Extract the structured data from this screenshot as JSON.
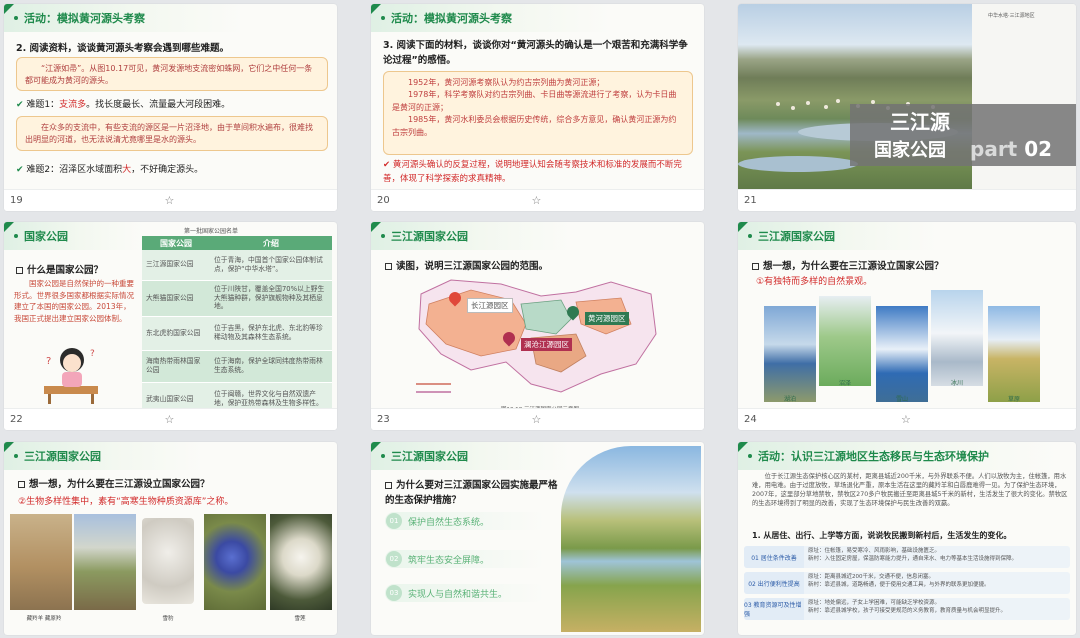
{
  "s19": {
    "num": "19",
    "title": "活动：模拟黄河源头考察",
    "q": "2.  阅读资料，谈谈黄河源头考察会遇到哪些难题。",
    "box1": "“江源如帚”。从图10.17可见，黄河发源地支流密如蛛网，它们之中任何一条都可能成为黄河的源头。",
    "d1a": "难题1：",
    "d1b": "支流多",
    "d1c": "。找长度最长、流量最大河段困难。",
    "box2": "在众多的支流中，有些支流的源区是一片沼泽地，由于草间积水遍布，很难找出明显的河道，也无法说清尤竟哪里是水的源头。",
    "d2a": "难题2：沼泽区水域面积",
    "d2b": "大",
    "d2c": "，不好确定源头。"
  },
  "s20": {
    "num": "20",
    "title": "活动：模拟黄河源头考察",
    "q": "3.  阅读下面的材料，谈谈你对“黄河源头的确认是一个艰苦和充满科学争论过程”的感悟。",
    "p1": "1952年，黄河河源考察队认为约古宗列曲为黄河正源；",
    "p2": "1978年，科学考察队对约古宗列曲、卡日曲等源流进行了考察，认为卡日曲是黄河的正源；",
    "p3": "1985年，黄河水利委员会根据历史传统，综合多方意见，确认黄河正源为约古宗列曲。",
    "tip": "黄河源头确认的反复过程，说明地理认知会随考察技术和标准的发展而不断完善，体现了科学探索的求真精神。"
  },
  "s21": {
    "num": "21",
    "tag": "中华水塔·三江源地区",
    "t1": "三江源",
    "t2": "国家公园",
    "part": "part",
    "pnum": "02"
  },
  "s22": {
    "num": "22",
    "title": "国家公园",
    "q": "什么是国家公园？",
    "body": "国家公园是自然保护的一种重要形式。世界很多国家都根据实际情况建立了本国的国家公园。2013年，我国正式提出建立国家公园体制。",
    "caption": "第一批国家公园名单",
    "h1": "国家公园",
    "h2": "介绍",
    "rows": [
      [
        "三江源国家公园",
        "位于青海，中国首个国家公园体制试点，保护“中华水塔”。"
      ],
      [
        "大熊猫国家公园",
        "位于川陕甘，覆盖全国70%以上野生大熊猫种群，保护旗舰物种及其栖息地。"
      ],
      [
        "东北虎豹国家公园",
        "位于吉黑，保护东北虎、东北豹等珍稀动物及其森林生态系统。"
      ],
      [
        "海南热带雨林国家公园",
        "位于海南，保护全球同纬度热带雨林生态系统。"
      ],
      [
        "武夷山国家公园",
        "位于闽赣，世界文化与自然双遗产地，保护亚热带森林及生物多样性。"
      ]
    ]
  },
  "s23": {
    "num": "23",
    "title": "三江源国家公园",
    "q": "读图，说明三江源国家公园的范围。",
    "l1": "长江源园区",
    "l2": "黄河源园区",
    "l3": "澜沧江源园区",
    "fig": "图10.18  三江源国家公园示意图"
  },
  "s24": {
    "num": "24",
    "title": "三江源国家公园",
    "q": "想一想，为什么要在三江源设立国家公园？",
    "a": "①有独特而多样的自然景观。",
    "photos": [
      "湖泊",
      "沼泽",
      "雪山",
      "冰川",
      "草原"
    ]
  },
  "s25": {
    "num": "",
    "title": "三江源国家公园",
    "q": "想一想，为什么要在三江源设立国家公园？",
    "a": "②生物多样性集中，素有“高寒生物种质资源库”之称。",
    "photos": [
      "藏羚羊 藏原羚",
      "",
      "雪豹",
      "",
      "雪莲"
    ]
  },
  "s26": {
    "num": "",
    "title": "三江源国家公园",
    "q": "为什么要对三江源国家公园实施最严格的生态保护措施？",
    "items": [
      {
        "n": "01",
        "t": "保护自然生态系统。"
      },
      {
        "n": "02",
        "t": "筑牢生态安全屏障。"
      },
      {
        "n": "03",
        "t": "实现人与自然和谐共生。"
      }
    ]
  },
  "s27": {
    "num": "",
    "title": "活动：认识三江源地区生态移民与生态环境保护",
    "body": "位于长江源生态保护核心区的某村，距离县城近200千米，与外界联系不便。人们以放牧为主，住帐篷，用水难，用电难。由于过度放牧，草场退化严重，原本生活在这里的藏羚羊和白唇鹿难得一见。为了保护生态环境，2007年，这里部分草地禁牧，禁牧区270多户牧民搬迁至距离县城5千米的新村，生活发生了很大的变化。禁牧区的生态环境得到了明显的改善，实现了生态环境保护与民生改善的双赢。",
    "q": "1. 从居住、出行、上学等方面，说说牧民搬到新村后，生活发生的变化。",
    "rows": [
      {
        "l": "01 居住条件改善",
        "t1": "原址：住帐篷，易受寒冷、风雨影响，基础设施匮乏。",
        "t2": "新村：入住固定房屋，保温防寒能力提升，通自来水、电力等基本生活设施得到保障。"
      },
      {
        "l": "02 出行便利性提高",
        "t1": "原址：距离县城近200千米，交通不便，信息闭塞。",
        "t2": "新村：靠近县城，道路畅通，便于使用交通工具，与外界的联系更加便捷。"
      },
      {
        "l": "03 教育资源可及性增强",
        "t1": "原址：地处偏远，子女上学困难，可能缺乏学校资源。",
        "t2": "新村：靠近县城学校，孩子可接受更规范的义务教育，教育质量与机会明显提升。"
      }
    ]
  }
}
